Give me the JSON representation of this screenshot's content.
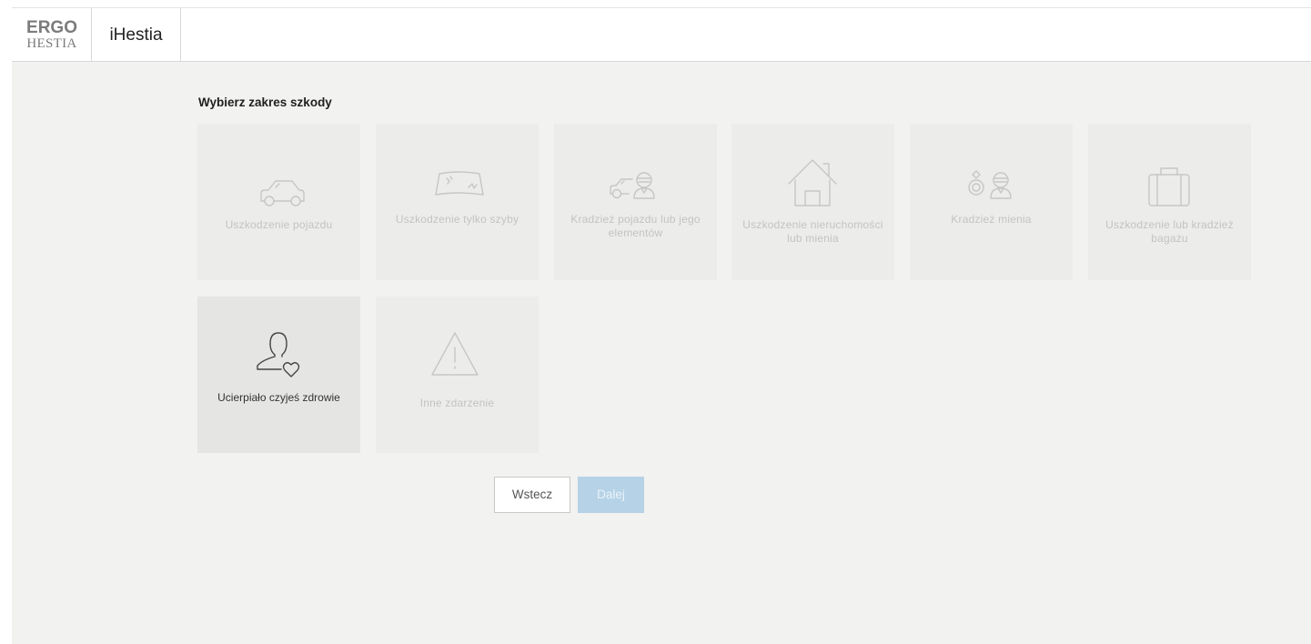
{
  "header": {
    "logo_top": "ERGO",
    "logo_bottom": "HESTIA",
    "app_name": "iHestia"
  },
  "main": {
    "title": "Wybierz zakres szkody",
    "tiles": [
      {
        "id": "vehicle-damage",
        "icon": "car-icon",
        "label": "Uszkodzenie pojazdu",
        "enabled": false
      },
      {
        "id": "glass-damage",
        "icon": "windshield-icon",
        "label": "Uszkodzenie tylko szyby",
        "enabled": false
      },
      {
        "id": "vehicle-theft",
        "icon": "car-thief-icon",
        "label": "Kradzież pojazdu lub jego elementów",
        "enabled": false
      },
      {
        "id": "property-damage",
        "icon": "house-icon",
        "label": "Uszkodzenie nieruchomości lub mienia",
        "enabled": false
      },
      {
        "id": "property-theft",
        "icon": "ring-thief-icon",
        "label": "Kradzież mienia",
        "enabled": false
      },
      {
        "id": "luggage",
        "icon": "suitcase-icon",
        "label": "Uszkodzenie lub kradzież bagażu",
        "enabled": false
      },
      {
        "id": "health",
        "icon": "person-heart-icon",
        "label": "Ucierpiało czyjeś zdrowie",
        "enabled": true
      },
      {
        "id": "other",
        "icon": "warning-icon",
        "label": "Inne zdarzenie",
        "enabled": false
      }
    ]
  },
  "actions": {
    "back_label": "Wstecz",
    "next_label": "Dalej"
  },
  "colors": {
    "background": "#f2f2f1",
    "tile": "#ececeb",
    "tile_active": "#e5e5e4",
    "disabled_text": "#c3c3c3",
    "primary_disabled": "#b6d2e6"
  }
}
